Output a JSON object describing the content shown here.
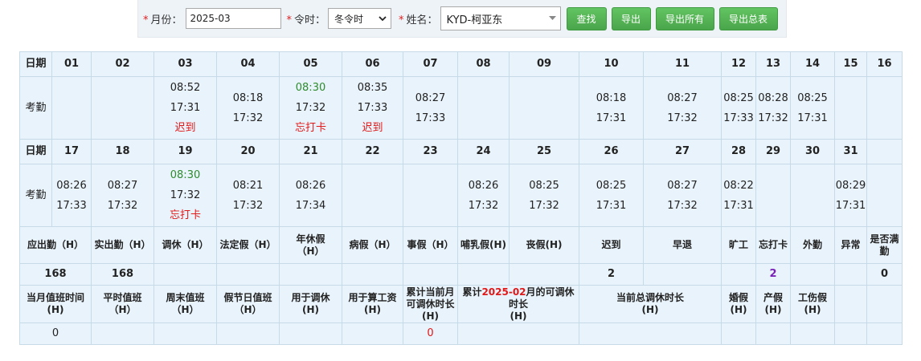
{
  "filters": {
    "month_label": "月份：",
    "month_value": "2025-03",
    "shift_label": "令时：",
    "shift_value": "冬令时",
    "name_label": "姓名：",
    "name_value": "KYD-柯亚东",
    "required_mark": "*"
  },
  "buttons": {
    "search": "查找",
    "export": "导出",
    "export_all": "导出所有",
    "export_summary": "导出总表"
  },
  "grid": {
    "date_label": "日期",
    "attendance_label": "考勤",
    "week1_dates": [
      "01",
      "02",
      "03",
      "04",
      "05",
      "06",
      "07",
      "08",
      "09",
      "10",
      "11",
      "12",
      "13",
      "14",
      "15",
      "16"
    ],
    "week1": [
      {
        "in": "",
        "out": "",
        "note": ""
      },
      {
        "in": "",
        "out": "",
        "note": ""
      },
      {
        "in": "08:52",
        "out": "17:31",
        "note": "迟到"
      },
      {
        "in": "08:18",
        "out": "17:32",
        "note": ""
      },
      {
        "in": "08:30",
        "out": "17:32",
        "note": "忘打卡"
      },
      {
        "in": "08:35",
        "out": "17:33",
        "note": "迟到"
      },
      {
        "in": "08:27",
        "out": "17:33",
        "note": ""
      },
      {
        "in": "",
        "out": "",
        "note": ""
      },
      {
        "in": "",
        "out": "",
        "note": ""
      },
      {
        "in": "08:18",
        "out": "17:31",
        "note": ""
      },
      {
        "in": "08:27",
        "out": "17:32",
        "note": ""
      },
      {
        "in": "08:25",
        "out": "17:33",
        "note": ""
      },
      {
        "in": "08:28",
        "out": "17:32",
        "note": ""
      },
      {
        "in": "08:25",
        "out": "17:31",
        "note": ""
      },
      {
        "in": "",
        "out": "",
        "note": ""
      },
      {
        "in": "",
        "out": "",
        "note": ""
      }
    ],
    "week2_dates": [
      "17",
      "18",
      "19",
      "20",
      "21",
      "22",
      "23",
      "24",
      "25",
      "26",
      "27",
      "28",
      "29",
      "30",
      "31",
      ""
    ],
    "week2": [
      {
        "in": "08:26",
        "out": "17:33",
        "note": ""
      },
      {
        "in": "08:27",
        "out": "17:32",
        "note": ""
      },
      {
        "in": "08:30",
        "out": "17:32",
        "note": "忘打卡"
      },
      {
        "in": "08:21",
        "out": "17:32",
        "note": ""
      },
      {
        "in": "08:26",
        "out": "17:34",
        "note": ""
      },
      {
        "in": "",
        "out": "",
        "note": ""
      },
      {
        "in": "",
        "out": "",
        "note": ""
      },
      {
        "in": "08:26",
        "out": "17:32",
        "note": ""
      },
      {
        "in": "08:25",
        "out": "17:32",
        "note": ""
      },
      {
        "in": "08:25",
        "out": "17:31",
        "note": ""
      },
      {
        "in": "08:27",
        "out": "17:32",
        "note": ""
      },
      {
        "in": "08:22",
        "out": "17:31",
        "note": ""
      },
      {
        "in": "",
        "out": "",
        "note": ""
      },
      {
        "in": "",
        "out": "",
        "note": ""
      },
      {
        "in": "08:29",
        "out": "17:31",
        "note": ""
      },
      {
        "in": "",
        "out": "",
        "note": ""
      }
    ],
    "colors": {
      "late": "#e01818",
      "forgot_in": "#2e8b2e"
    }
  },
  "summary": {
    "headers": [
      [
        "应出勤（H）"
      ],
      [
        "实出勤（H）"
      ],
      [
        "调休（H）"
      ],
      [
        "法定假（H）"
      ],
      [
        "年休假",
        "（H）"
      ],
      [
        "病假（H）"
      ],
      [
        "事假（H）"
      ],
      [
        "哺乳假(H)"
      ],
      [
        "丧假(H)"
      ],
      [
        "迟到"
      ],
      [
        "早退"
      ],
      [
        "旷工"
      ],
      [
        "忘打卡"
      ],
      [
        "外勤"
      ],
      [
        "异常"
      ],
      [
        "是否满",
        "勤"
      ]
    ],
    "values": [
      "168",
      "168",
      "",
      "",
      "",
      "",
      "",
      "",
      "",
      "2",
      "",
      "",
      "2",
      "",
      "",
      "0"
    ]
  },
  "overtime": {
    "headers": [
      [
        "当月值班时间",
        "(H)"
      ],
      [
        "平时值班",
        "（H）"
      ],
      [
        "周末值班",
        "（H）"
      ],
      [
        "假节日值班",
        "（H）"
      ],
      [
        "用于调休",
        "(H)"
      ],
      [
        "用于算工资",
        "(H)"
      ],
      [
        "累计当前月可调休时长",
        "(H)"
      ],
      [
        "累计",
        "2025-02",
        "月的可调休时长",
        "(H)"
      ],
      [
        "当前总调休时长",
        "(H)"
      ],
      [
        "婚假",
        "(H)"
      ],
      [
        "产假",
        "(H)"
      ],
      [
        "工伤假",
        "(H)"
      ]
    ],
    "values": [
      "0",
      "",
      "",
      "",
      "",
      "",
      "0",
      "",
      "",
      "",
      "",
      ""
    ]
  }
}
